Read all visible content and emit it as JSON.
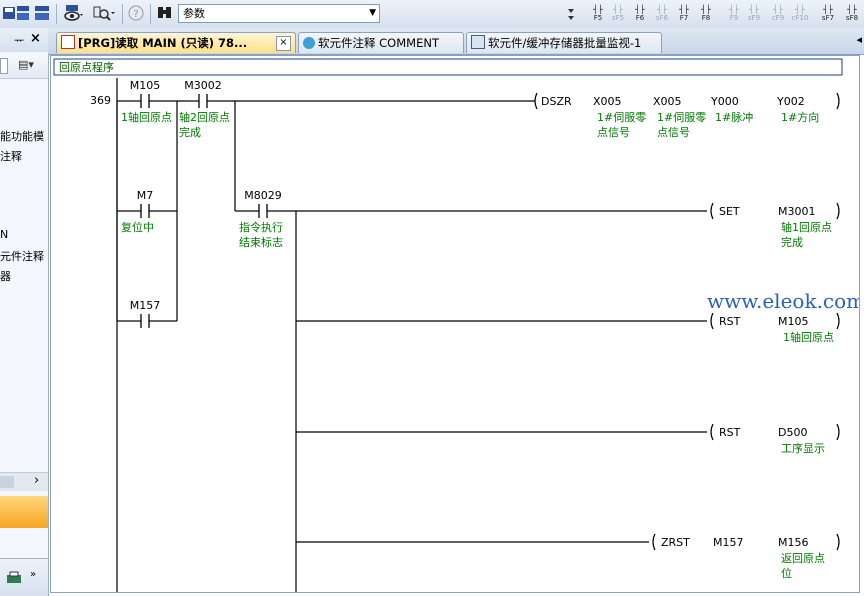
{
  "toolbar": {
    "combo_value": "参数",
    "fkeys": [
      {
        "label": "F5",
        "dim": false
      },
      {
        "label": "sF5",
        "dim": true
      },
      {
        "label": "F6",
        "dim": false
      },
      {
        "label": "sF6",
        "dim": true
      },
      {
        "label": "F7",
        "dim": false
      },
      {
        "label": "F8",
        "dim": false
      },
      {
        "label": "F9",
        "dim": true
      },
      {
        "label": "sF9",
        "dim": true
      },
      {
        "label": "cF9",
        "dim": true
      },
      {
        "label": "cF10",
        "dim": true
      },
      {
        "label": "sF7",
        "dim": false
      },
      {
        "label": "sF8",
        "dim": false
      }
    ]
  },
  "left_panel": {
    "pin": "ᅲ",
    "close": "×",
    "texts": [
      "能功能模",
      "注释",
      "N",
      "元件注释",
      "器"
    ],
    "scroll_arrow": "›"
  },
  "tabs": [
    {
      "label": "[PRG]读取 MAIN (只读) 78...",
      "active": true
    },
    {
      "label": "软元件注释 COMMENT",
      "active": false
    },
    {
      "label": "软元件/缓冲存储器批量监视-1",
      "active": false
    }
  ],
  "tab_scroll": "◂",
  "ladder": {
    "title": "回原点程序",
    "step": "369",
    "contacts": [
      {
        "device": "M105",
        "comment": [
          "1轴回原点"
        ]
      },
      {
        "device": "M3002",
        "comment": [
          "轴2回原点",
          "完成"
        ]
      },
      {
        "device": "M7",
        "comment": [
          "复位中"
        ]
      },
      {
        "device": "M8029",
        "comment": [
          "指令执行",
          "结束标志"
        ]
      },
      {
        "device": "M157",
        "comment": []
      }
    ],
    "instructions": [
      {
        "op": "DSZR",
        "operands": [
          {
            "device": "X005",
            "comment": [
              "1#伺服零",
              "点信号"
            ]
          },
          {
            "device": "X005",
            "comment": [
              "1#伺服零",
              "点信号"
            ]
          },
          {
            "device": "Y000",
            "comment": [
              "1#脉冲"
            ]
          },
          {
            "device": "Y002",
            "comment": [
              "1#方向"
            ]
          }
        ]
      },
      {
        "op": "SET",
        "operands": [
          {
            "device": "M3001",
            "comment": [
              "轴1回原点",
              "完成"
            ]
          }
        ]
      },
      {
        "op": "RST",
        "operands": [
          {
            "device": "M105",
            "comment": [
              "1轴回原点"
            ]
          }
        ]
      },
      {
        "op": "RST",
        "operands": [
          {
            "device": "D500",
            "comment": [
              "工序显示"
            ]
          }
        ]
      },
      {
        "op": "ZRST",
        "operands": [
          {
            "device": "M157",
            "comment": []
          },
          {
            "device": "M156",
            "comment": [
              "返回原点",
              "位"
            ]
          }
        ]
      }
    ]
  },
  "watermark": "www.eleok.com"
}
